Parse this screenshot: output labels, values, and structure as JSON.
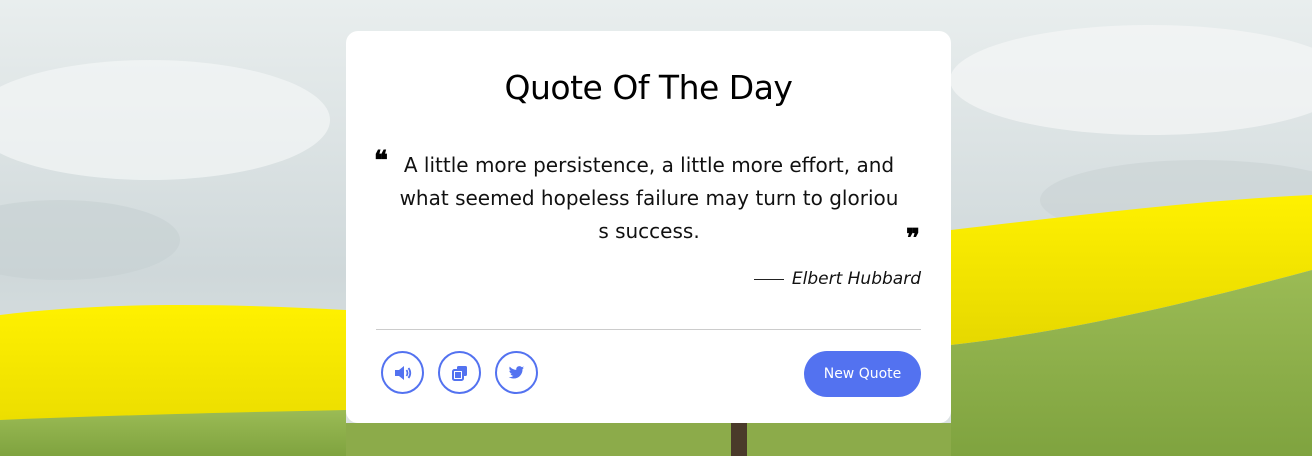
{
  "card": {
    "title": "Quote Of The Day",
    "quote_open_glyph": "❝",
    "quote_text": "A little more persistence, a little more effort, and what seemed hopeless failure may turn to glorious success.",
    "quote_close_glyph": "❞",
    "author": "Elbert Hubbard"
  },
  "actions": {
    "speak_icon": "speaker-icon",
    "copy_icon": "copy-icon",
    "twitter_icon": "twitter-icon",
    "new_quote_label": "New Quote"
  },
  "colors": {
    "accent": "#5372f0",
    "sky": "#dfe6e8",
    "field_yellow": "#f4e600",
    "field_green": "#8cb04a"
  }
}
